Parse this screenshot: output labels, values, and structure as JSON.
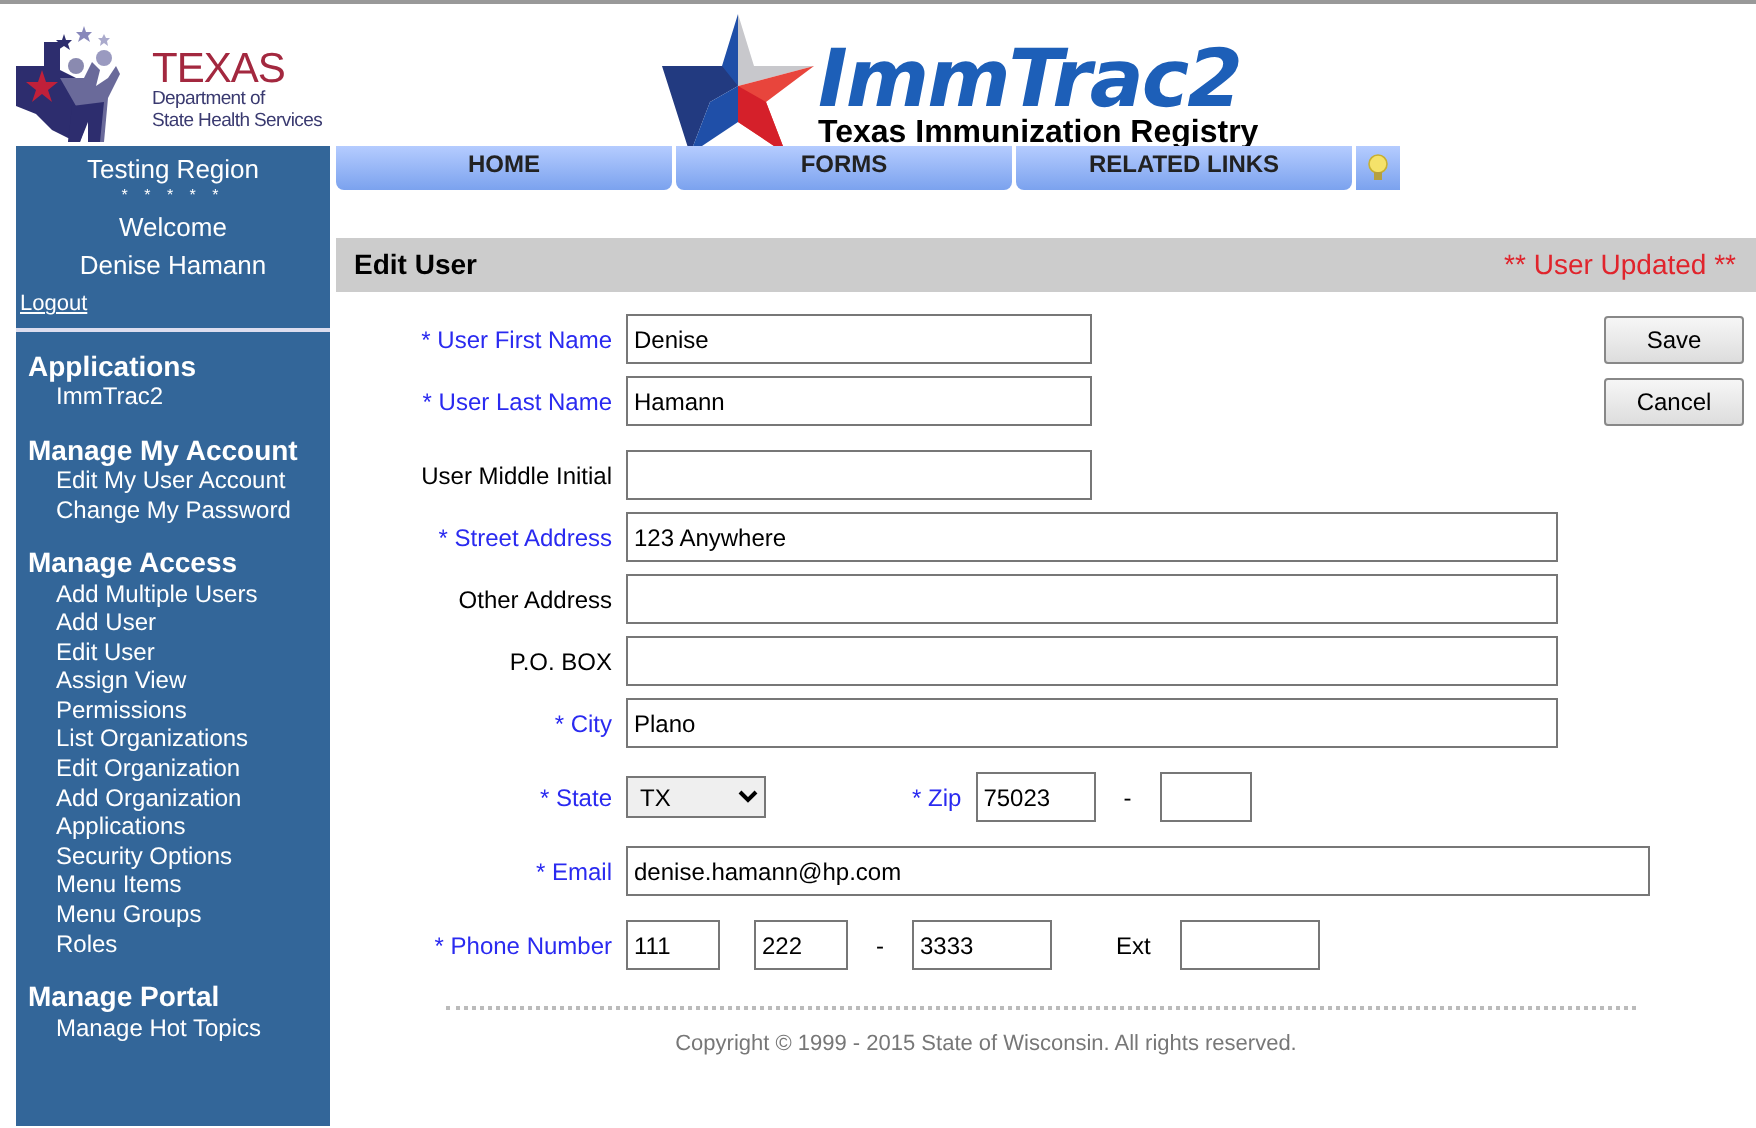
{
  "header": {
    "agency_logo": {
      "name": "TEXAS",
      "line_1": "Department of",
      "line_2": "State Health Services"
    },
    "app_logo": {
      "name": "ImmTrac2",
      "tagline": "Texas Immunization Registry"
    }
  },
  "nav": {
    "tabs": [
      "HOME",
      "FORMS",
      "RELATED LINKS"
    ]
  },
  "sidebar": {
    "region": "Testing Region",
    "stars": "* * * * *",
    "welcome": "Welcome",
    "user": "Denise Hamann",
    "logout": "Logout",
    "groups": [
      {
        "heading": "Applications",
        "items": [
          "ImmTrac2"
        ]
      },
      {
        "heading": "Manage My Account",
        "items": [
          "Edit My User Account",
          "Change My Password"
        ]
      },
      {
        "heading": "Manage Access",
        "items": [
          "Add Multiple Users",
          "Add User",
          "Edit User",
          "Assign View Permissions",
          "List Organizations",
          "Edit Organization",
          "Add Organization",
          "Applications",
          "Security Options",
          "Menu Items",
          "Menu Groups",
          "Roles"
        ]
      },
      {
        "heading": "Manage Portal",
        "items": [
          "Manage Hot Topics"
        ]
      }
    ]
  },
  "page": {
    "title": "Edit User",
    "message": "** User Updated **"
  },
  "form": {
    "rows": [
      {
        "kind": "short",
        "label": "* User First Name",
        "required": true,
        "value": "Denise"
      },
      {
        "kind": "short",
        "label": "* User Last Name",
        "required": true,
        "value": "Hamann"
      },
      {
        "kind": "short",
        "label": "User Middle Initial",
        "required": false
      },
      {
        "kind": "long",
        "label": "* Street Address",
        "required": true,
        "value": "123 Anywhere"
      },
      {
        "kind": "long",
        "label": "Other Address",
        "required": false
      },
      {
        "kind": "long",
        "label": "P.O. BOX",
        "required": false
      },
      {
        "kind": "long",
        "label": "* City",
        "required": true,
        "value": "Plano"
      },
      {
        "kind": "state_zip",
        "label": "* State",
        "required": true,
        "value": "TX",
        "zip_label": "* Zip",
        "zip_required": true,
        "zip": "75023",
        "separator": "-"
      },
      {
        "kind": "wide",
        "label": "* Email",
        "required": true,
        "value": "denise.hamann@hp.com"
      },
      {
        "kind": "phone",
        "label": "* Phone Number",
        "required": true,
        "parts": [
          "111",
          "222",
          "3333"
        ],
        "separator": "-",
        "ext_label": "Ext"
      }
    ],
    "buttons": [
      "Save",
      "Cancel"
    ]
  },
  "footer": {
    "copyright": "Copyright © 1999 - 2015 State of Wisconsin. All rights reserved."
  }
}
